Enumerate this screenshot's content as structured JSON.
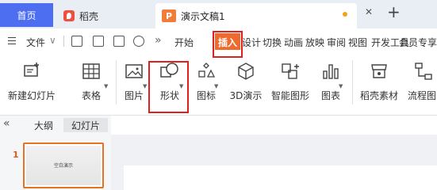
{
  "tabs": {
    "home": "首页",
    "daoke": "稻壳",
    "doc": "演示文稿1",
    "add": "+"
  },
  "menu": {
    "file": "文件",
    "more": "»",
    "items": [
      "开始",
      "插入",
      "设计",
      "切换",
      "动画",
      "放映",
      "审阅",
      "视图",
      "开发工具",
      "会员专享"
    ]
  },
  "ribbon": {
    "new_slide": "新建幻灯片",
    "table": "表格",
    "picture": "图片",
    "shape": "形状",
    "icon": "图标",
    "threed": "3D演示",
    "smart_graphic": "智能图形",
    "chart": "图表",
    "daoke_material": "稻壳素材",
    "flowchart": "流程图"
  },
  "pane": {
    "collapse": "«",
    "outline": "大纲",
    "slides": "幻灯片",
    "slide_number": "1",
    "thumb_title": "空白演示"
  },
  "colors": {
    "accent_home": "#4e6ef2",
    "insert_highlight": "#ee6b30",
    "annotation": "#e02020",
    "slide_selected": "#e8721f"
  }
}
